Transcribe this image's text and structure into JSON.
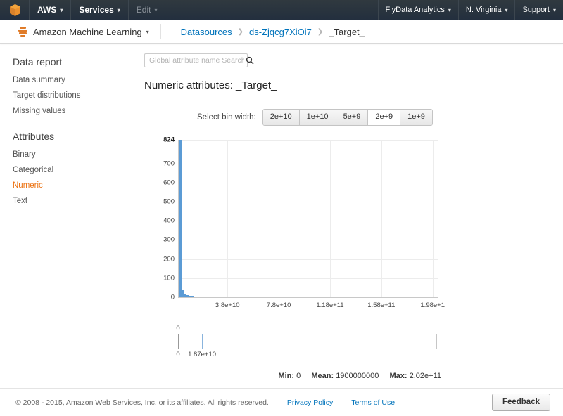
{
  "aws_nav": {
    "logo_icon": "aws-cube-icon",
    "left_items": [
      {
        "label": "AWS",
        "caret": "▾",
        "dim": false
      },
      {
        "label": "Services",
        "caret": "▾",
        "dim": false
      },
      {
        "label": "Edit",
        "caret": "▾",
        "dim": true
      }
    ],
    "right_items": [
      {
        "label": "FlyData Analytics",
        "caret": "▾"
      },
      {
        "label": "N. Virginia",
        "caret": "▾"
      },
      {
        "label": "Support",
        "caret": "▾"
      }
    ]
  },
  "service_bar": {
    "icon": "amazon-machine-learning-icon",
    "service_name": "Amazon Machine Learning",
    "caret": "▾",
    "breadcrumb": [
      {
        "label": "Datasources",
        "link": true
      },
      {
        "label": "ds-Zjqcg7XiOi7",
        "link": true
      },
      {
        "label": "_Target_",
        "link": false
      }
    ],
    "separator": "❯"
  },
  "sidebar": {
    "groups": [
      {
        "title": "Data report",
        "items": [
          {
            "label": "Data summary",
            "active": false
          },
          {
            "label": "Target distributions",
            "active": false
          },
          {
            "label": "Missing values",
            "active": false
          }
        ]
      },
      {
        "title": "Attributes",
        "items": [
          {
            "label": "Binary",
            "active": false
          },
          {
            "label": "Categorical",
            "active": false
          },
          {
            "label": "Numeric",
            "active": true
          },
          {
            "label": "Text",
            "active": false
          }
        ]
      }
    ]
  },
  "search": {
    "placeholder": "Global attribute name Search",
    "value": "",
    "icon": "search-icon"
  },
  "main": {
    "section_title": "Numeric attributes: _Target_",
    "binwidth_label": "Select bin width:",
    "binwidth_options": [
      "2e+10",
      "1e+10",
      "5e+9",
      "2e+9",
      "1e+9"
    ],
    "binwidth_selected": "2e+9"
  },
  "stats": {
    "min_key": "Min:",
    "min_value": "0",
    "mean_key": "Mean:",
    "mean_value": "1900000000",
    "max_key": "Max:",
    "max_value": "2.02e+11"
  },
  "boxplot": {
    "label_top_left": "0",
    "label_bottom_left": "0",
    "label_bottom_median": "1.87e+10",
    "min": 0,
    "median": 18700000000.0,
    "max": 202000000000.0,
    "whisker_end": 18700000000.0
  },
  "footer": {
    "copyright": "© 2008 - 2015, Amazon Web Services, Inc. or its affiliates. All rights reserved.",
    "links": [
      "Privacy Policy",
      "Terms of Use"
    ],
    "feedback_label": "Feedback"
  },
  "chart_data": {
    "type": "bar",
    "title": "Numeric attributes: _Target_",
    "xlabel": "",
    "ylabel": "",
    "grid": true,
    "legend": false,
    "bin_width": 2000000000,
    "xlim": [
      0,
      202000000000
    ],
    "ylim": [
      0,
      824
    ],
    "x_tick_labels": [
      "3.8e+10",
      "7.8e+10",
      "1.18e+11",
      "1.58e+11",
      "1.98e+1"
    ],
    "x_tick_values": [
      38000000000,
      78000000000,
      118000000000,
      158000000000,
      198000000000
    ],
    "y_tick_labels": [
      "824",
      "700",
      "600",
      "500",
      "400",
      "300",
      "200",
      "100",
      "0"
    ],
    "y_tick_values": [
      824,
      700,
      600,
      500,
      400,
      300,
      200,
      100,
      0
    ],
    "bar_color": "#5b9bd5",
    "bin_starts": [
      0,
      2000000000,
      4000000000,
      6000000000,
      8000000000,
      10000000000,
      12000000000,
      14000000000,
      16000000000,
      18000000000,
      20000000000,
      22000000000,
      24000000000,
      26000000000,
      28000000000,
      30000000000,
      32000000000,
      34000000000,
      36000000000,
      38000000000,
      40000000000,
      44000000000,
      50000000000,
      60000000000,
      70000000000,
      80000000000,
      100000000000,
      120000000000,
      150000000000,
      200000000000
    ],
    "values": [
      824,
      38,
      20,
      12,
      9,
      6,
      5,
      4,
      3,
      3,
      2,
      2,
      2,
      2,
      2,
      3,
      2,
      1,
      1,
      2,
      1,
      1,
      1,
      1,
      1,
      1,
      1,
      1,
      1,
      1
    ]
  }
}
